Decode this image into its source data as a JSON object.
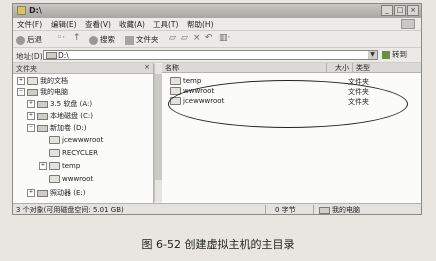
{
  "window": {
    "title": "D:\\",
    "menu": [
      "文件(F)",
      "编辑(E)",
      "查看(V)",
      "收藏(A)",
      "工具(T)",
      "帮助(H)"
    ],
    "toolbar": {
      "back": "后退",
      "search": "搜索",
      "folders": "文件夹"
    },
    "address": {
      "label": "地址(D)",
      "value": "D:\\",
      "go": "转到"
    }
  },
  "left_pane": {
    "title": "文件夹",
    "close": "×",
    "tree": [
      {
        "label": "我的文档",
        "exp": "+"
      },
      {
        "label": "我的电脑",
        "exp": "−"
      },
      {
        "label": "3.5 软盘 (A:)",
        "exp": "+"
      },
      {
        "label": "本地磁盘 (C:)",
        "exp": "+"
      },
      {
        "label": "新加卷 (D:)",
        "exp": "−"
      },
      {
        "label": "jcewwwroot",
        "exp": ""
      },
      {
        "label": "RECYCLER",
        "exp": ""
      },
      {
        "label": "temp",
        "exp": "+"
      },
      {
        "label": "wwwroot",
        "exp": ""
      },
      {
        "label": "照动器 (E:)",
        "exp": "+"
      }
    ]
  },
  "right_pane": {
    "columns": {
      "name": "名称",
      "size": "大小",
      "type": "类型"
    },
    "files": [
      {
        "name": "temp",
        "type": "文件夹"
      },
      {
        "name": "wwwroot",
        "type": "文件夹"
      },
      {
        "name": "jcewwwroot",
        "type": "文件夹"
      }
    ]
  },
  "status": {
    "objects": "3 个对象(可用磁盘空间: 5.01 GB)",
    "size": "0 字节",
    "location": "我的电脑"
  },
  "caption": "图 6-52   创建虚拟主机的主目录"
}
